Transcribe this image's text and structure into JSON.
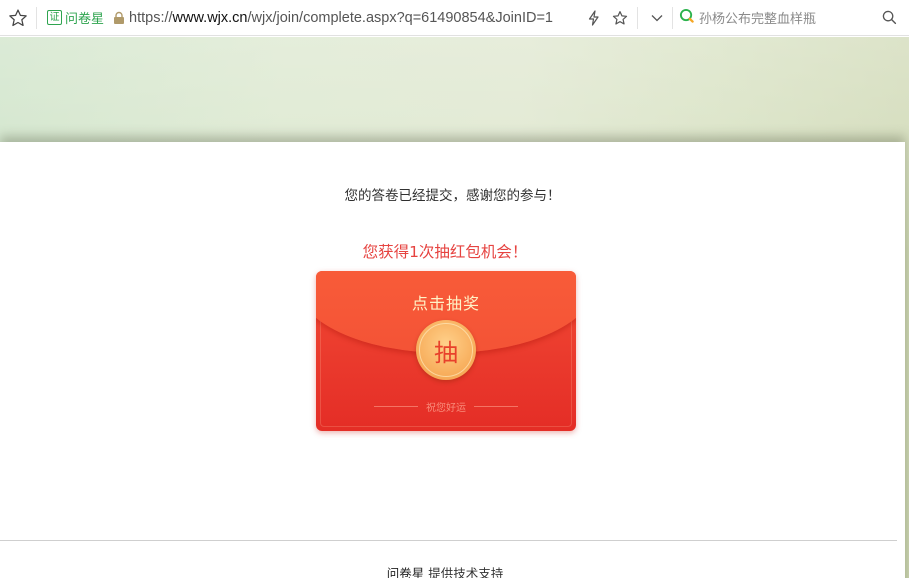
{
  "browser": {
    "cert_badge": "证",
    "site_name": "问卷星",
    "url_prefix": "https://",
    "url_domain": "www.wjx.cn",
    "url_path": "/wjx/join/complete.aspx?q=61490854&JoinID=1",
    "search_text": "孙杨公布完整血样瓶"
  },
  "page": {
    "submitted_message": "您的答卷已经提交，感谢您的参与！",
    "prize_message": "您获得1次抽红包机会！",
    "envelope": {
      "title": "点击抽奖",
      "draw_label": "抽",
      "luck_text": "祝您好运"
    },
    "footer": {
      "brand": "问卷星",
      "text": "提供技术支持"
    }
  },
  "colors": {
    "accent_red": "#e64340",
    "envelope_red": "#e42d26",
    "coin_gold": "#f8b05f",
    "cert_green": "#2ea44f"
  }
}
